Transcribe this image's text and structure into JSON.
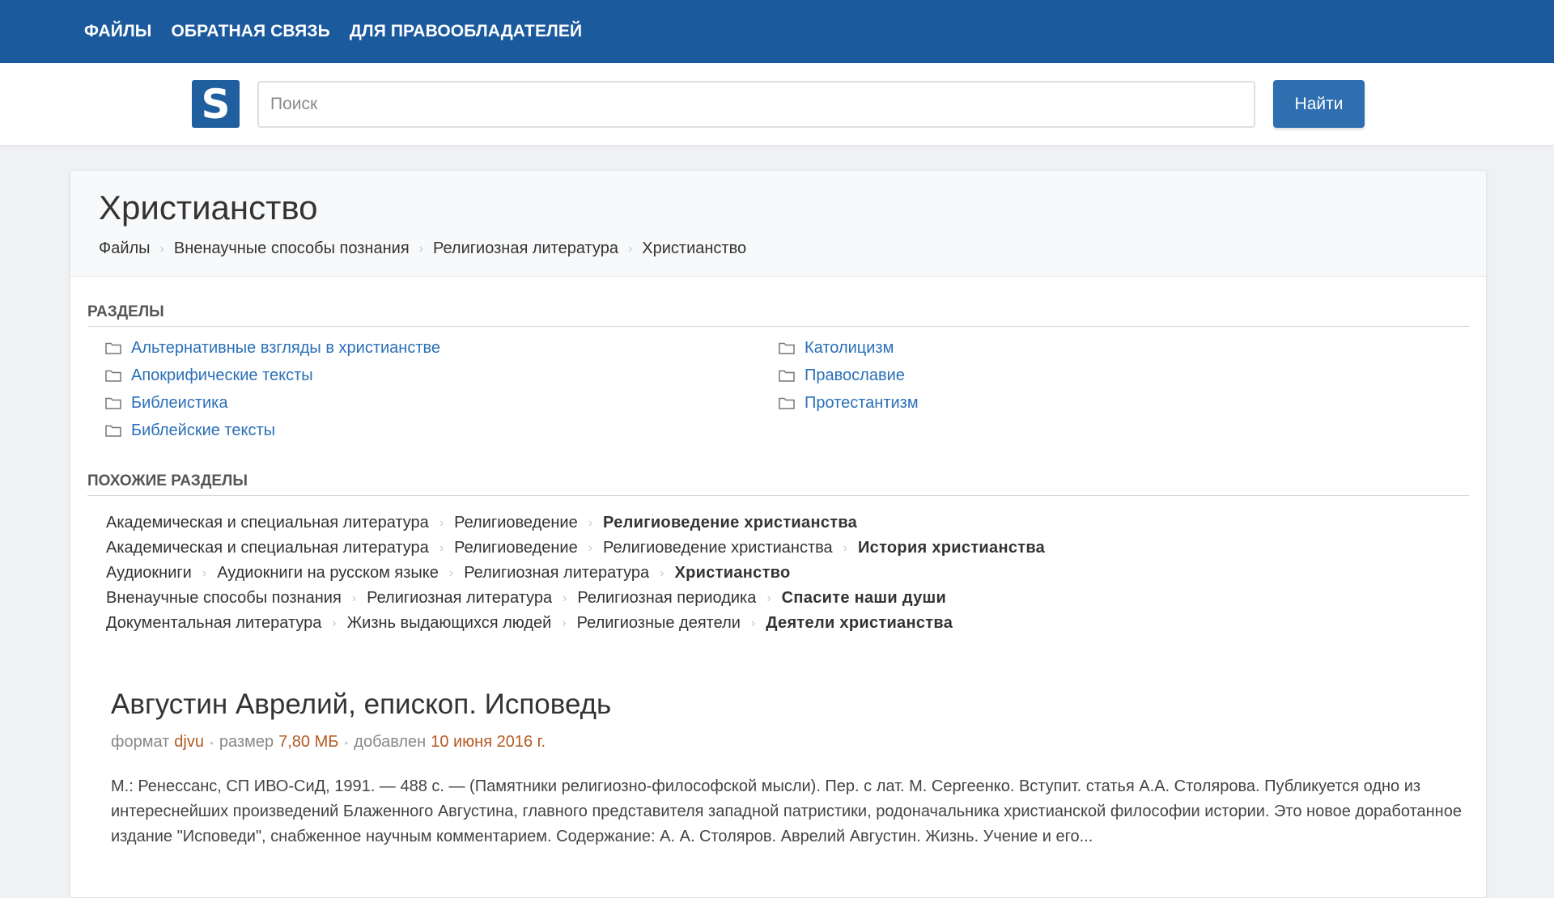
{
  "nav": {
    "files": "ФАЙЛЫ",
    "feedback": "ОБРАТНАЯ СВЯЗЬ",
    "rightholders": "ДЛЯ ПРАВООБЛАДАТЕЛЕЙ"
  },
  "search": {
    "logo_letter": "S",
    "placeholder": "Поиск",
    "button": "Найти"
  },
  "page": {
    "title": "Христианство",
    "breadcrumb": [
      "Файлы",
      "Вненаучные способы познания",
      "Религиозная литература",
      "Христианство"
    ]
  },
  "sections": {
    "heading": "РАЗДЕЛЫ",
    "left": [
      "Альтернативные взгляды в христианстве",
      "Апокрифические тексты",
      "Библеистика",
      "Библейские тексты"
    ],
    "right": [
      "Католицизм",
      "Православие",
      "Протестантизм"
    ]
  },
  "similar": {
    "heading": "ПОХОЖИЕ РАЗДЕЛЫ",
    "rows": [
      [
        "Академическая и специальная литература",
        "Религиоведение",
        "Религиоведение христианства"
      ],
      [
        "Академическая и специальная литература",
        "Религиоведение",
        "Религиоведение христианства",
        "История христианства"
      ],
      [
        "Аудиокниги",
        "Аудиокниги на русском языке",
        "Религиозная литература",
        "Христианство"
      ],
      [
        "Вненаучные способы познания",
        "Религиозная литература",
        "Религиозная периодика",
        "Спасите наши души"
      ],
      [
        "Документальная литература",
        "Жизнь выдающихся людей",
        "Религиозные деятели",
        "Деятели христианства"
      ]
    ]
  },
  "result": {
    "title": "Августин Аврелий, епископ. Исповедь",
    "format_label": "формат",
    "format_value": "djvu",
    "size_label": "размер",
    "size_value": "7,80 МБ",
    "added_label": "добавлен",
    "added_value": "10 июня 2016 г.",
    "description": "М.: Ренессанс, СП ИВО-СиД, 1991. — 488 с. — (Памятники религиозно-философской мысли). Пер. с лат. М. Сергеенко. Вступит. статья А.А. Столярова. Публикуется одно из интереснейших произведений Блаженного Августина, главного представителя западной патристики, родоначальника христианской философии истории. Это новое доработанное издание \"Исповеди\", снабженное научным комментарием. Содержание: А. А. Столяров. Аврелий Августин. Жизнь. Учение и его..."
  },
  "colors": {
    "nav_bg": "#1c5a9e",
    "link": "#2a6fb8",
    "meta_value": "#b35a22",
    "button_bg": "#2f6fb0"
  }
}
